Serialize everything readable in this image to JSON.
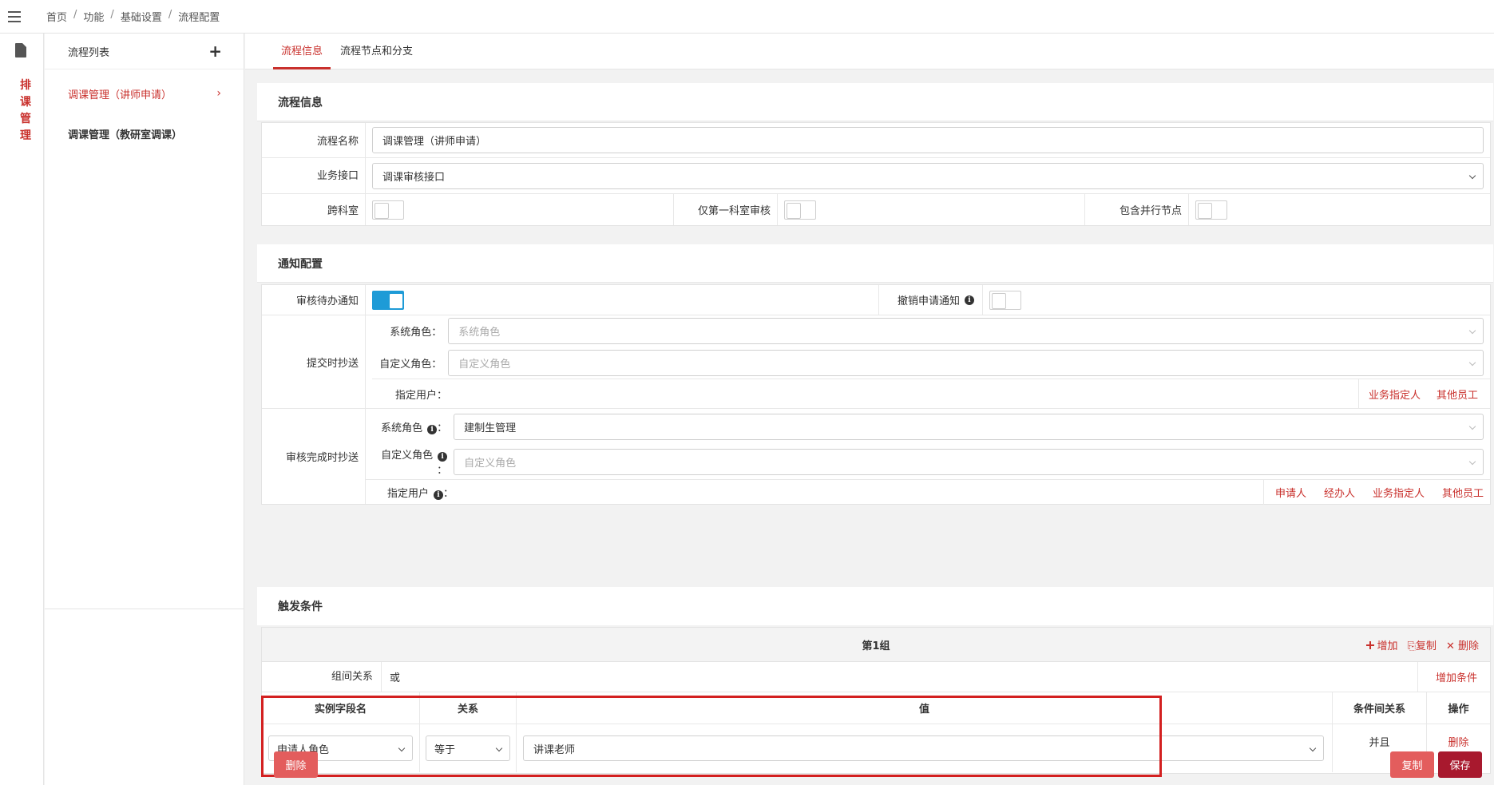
{
  "breadcrumb": [
    "首页",
    "功能",
    "基础设置",
    "流程配置"
  ],
  "rail": {
    "label": "排课管理"
  },
  "flow_list": {
    "title": "流程列表",
    "items": [
      {
        "label": "调课管理（讲师申请）",
        "active": true
      },
      {
        "label": "调课管理（教研室调课）",
        "active": false
      }
    ]
  },
  "tabs": [
    {
      "label": "流程信息",
      "active": true
    },
    {
      "label": "流程节点和分支",
      "active": false
    }
  ],
  "flow_info": {
    "title": "流程信息",
    "name_label": "流程名称",
    "name_value": "调课管理（讲师申请）",
    "api_label": "业务接口",
    "api_value": "调课审核接口",
    "cross_dept_label": "跨科室",
    "cross_dept_on": false,
    "first_dept_label": "仅第一科室审核",
    "first_dept_on": false,
    "parallel_label": "包含并行节点",
    "parallel_on": false
  },
  "notify": {
    "title": "通知配置",
    "todo_label": "审核待办通知",
    "todo_on": true,
    "cancel_label": "撤销申请通知",
    "cancel_on": false,
    "submit_cc": {
      "label": "提交时抄送",
      "sys_role_label": "系统角色：",
      "sys_role_placeholder": "系统角色",
      "custom_role_label": "自定义角色：",
      "custom_role_placeholder": "自定义角色",
      "user_label": "指定用户：",
      "links": [
        "业务指定人",
        "其他员工"
      ]
    },
    "done_cc": {
      "label": "审核完成时抄送",
      "sys_role_label": "系统角色",
      "sys_role_value": "建制生管理",
      "custom_role_label": "自定义角色",
      "custom_role_placeholder": "自定义角色",
      "user_label": "指定用户",
      "links": [
        "申请人",
        "经办人",
        "业务指定人",
        "其他员工"
      ]
    }
  },
  "trigger": {
    "title": "触发条件",
    "group_title": "第1组",
    "group_actions": {
      "add": "增加",
      "copy": "复制",
      "delete": "删除"
    },
    "relation_label": "组间关系",
    "relation_value": "或",
    "add_condition": "增加条件",
    "columns": {
      "field": "实例字段名",
      "relation": "关系",
      "value": "值",
      "between": "条件间关系",
      "op": "操作"
    },
    "row": {
      "field": "申请人角色",
      "relation": "等于",
      "value": "讲课老师",
      "between": "并且",
      "op": "删除"
    }
  },
  "footer": {
    "delete": "删除",
    "copy": "复制",
    "save": "保存"
  },
  "colors": {
    "accent": "#c9302c",
    "toggle_on": "#1e9bd7",
    "save": "#a8192e",
    "highlight": "#d32020"
  }
}
